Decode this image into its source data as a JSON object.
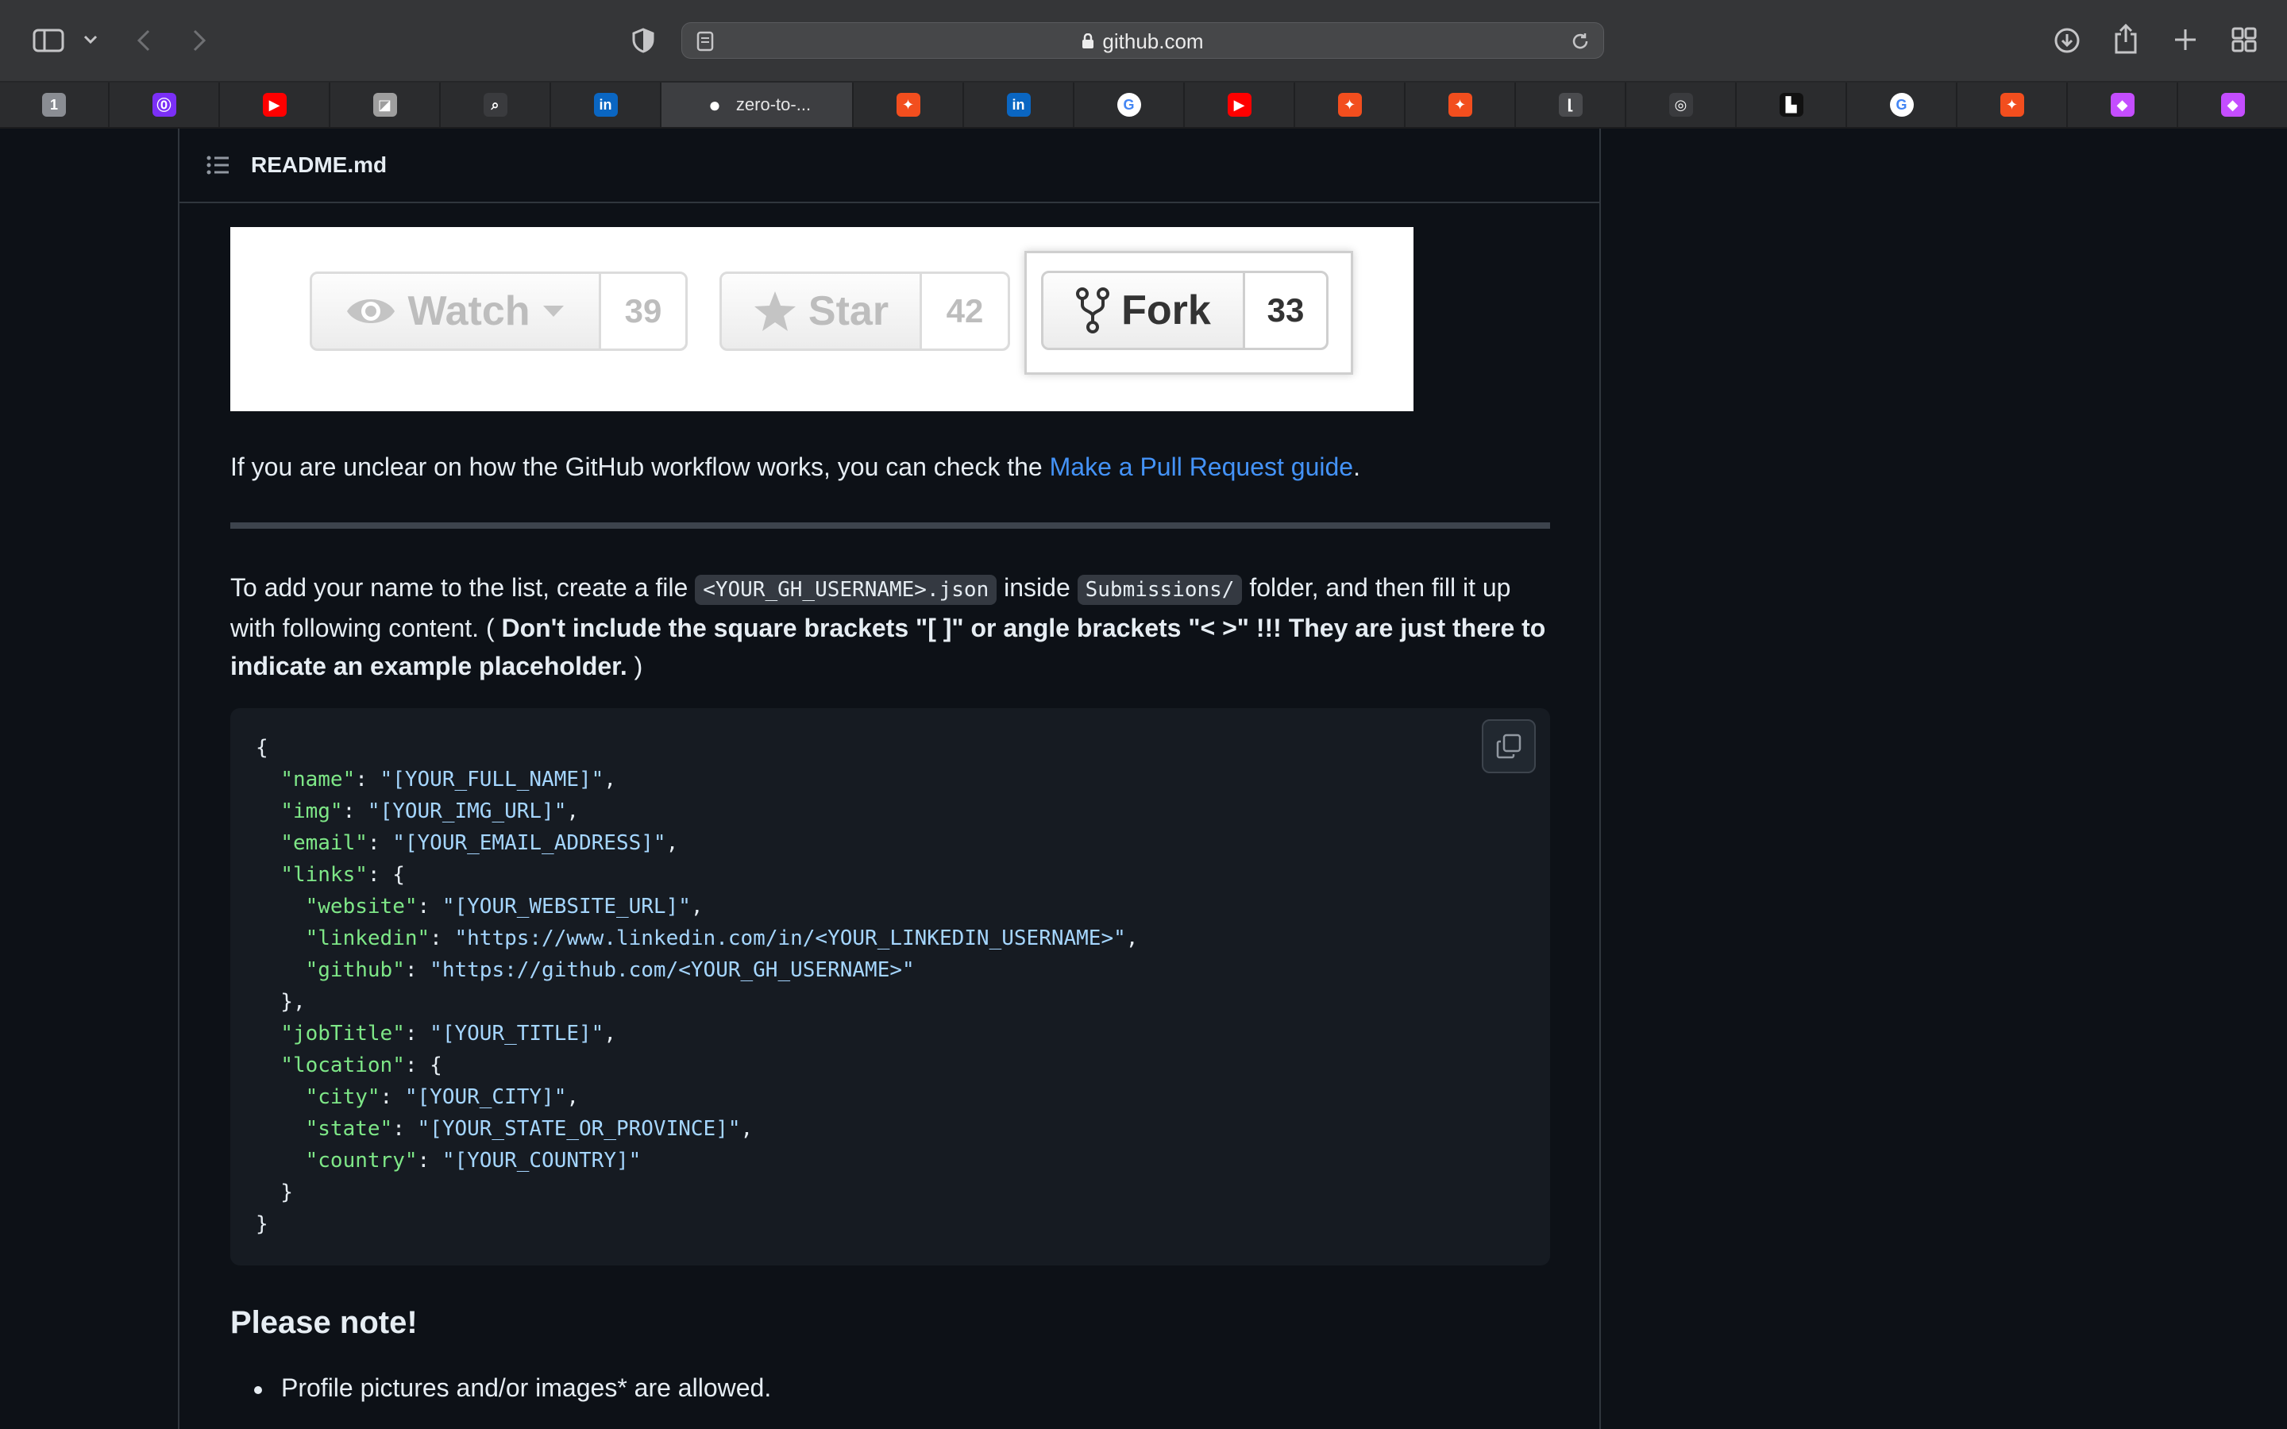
{
  "browser": {
    "url": "github.com",
    "active_tab_label": "zero-to-...",
    "tabs": [
      {
        "icon": "1password-icon",
        "color": "#8a8d93",
        "glyph": "1"
      },
      {
        "icon": "app-icon",
        "color": "#7b2ff7",
        "glyph": "⓪"
      },
      {
        "icon": "youtube-icon",
        "color": "#ff0000",
        "glyph": "▶"
      },
      {
        "icon": "app-icon",
        "color": "#9e9e9e",
        "glyph": "◪"
      },
      {
        "icon": "search-app-icon",
        "color": "#3a3b3e",
        "glyph": "⌕"
      },
      {
        "icon": "linkedin-icon",
        "color": "#0a66c2",
        "glyph": "in"
      },
      {
        "icon": "github-icon",
        "color": "#3d3e41",
        "glyph": "●"
      },
      {
        "icon": "figma-icon",
        "color": "#f24e1e",
        "glyph": "✦"
      },
      {
        "icon": "linkedin-icon",
        "color": "#0a66c2",
        "glyph": "in"
      },
      {
        "icon": "google-icon",
        "color": "#ffffff",
        "glyph": "G"
      },
      {
        "icon": "youtube-icon",
        "color": "#ff0000",
        "glyph": "▶"
      },
      {
        "icon": "figma-icon",
        "color": "#f24e1e",
        "glyph": "✦"
      },
      {
        "icon": "figma-icon",
        "color": "#f24e1e",
        "glyph": "✦"
      },
      {
        "icon": "app-icon",
        "color": "#4a4b4e",
        "glyph": "⌊"
      },
      {
        "icon": "compass-icon",
        "color": "#3a3b3e",
        "glyph": "◎"
      },
      {
        "icon": "unsplash-icon",
        "color": "#111111",
        "glyph": "▙"
      },
      {
        "icon": "google-icon",
        "color": "#ffffff",
        "glyph": "G"
      },
      {
        "icon": "figma-icon",
        "color": "#f24e1e",
        "glyph": "✦"
      },
      {
        "icon": "app-icon",
        "color": "#c44dff",
        "glyph": "◆"
      },
      {
        "icon": "app-icon",
        "color": "#c44dff",
        "glyph": "◆"
      }
    ]
  },
  "readme": {
    "title": "README.md",
    "buttons": {
      "watch_label": "Watch",
      "watch_count": "39",
      "star_label": "Star",
      "star_count": "42",
      "fork_label": "Fork",
      "fork_count": "33"
    },
    "para1_text": "If you are unclear on how the GitHub workflow works, you can check the ",
    "para1_link": "Make a Pull Request guide",
    "para1_end": ".",
    "para2": {
      "t1": "To add your name to the list, create a file ",
      "code1": "<YOUR_GH_USERNAME>.json",
      "t2": " inside ",
      "code2": "Submissions/",
      "t3": " folder, and then fill it up with following content. ( ",
      "bold": "Don't include the square brackets \"[ ]\" or angle brackets \"< >\" !!! They are just there to indicate an example placeholder.",
      "t4": " )"
    },
    "code": {
      "name_val": "\"[YOUR_FULL_NAME]\"",
      "img_val": "\"[YOUR_IMG_URL]\"",
      "email_val": "\"[YOUR_EMAIL_ADDRESS]\"",
      "website_val": "\"[YOUR_WEBSITE_URL]\"",
      "linkedin_val": "\"https://www.linkedin.com/in/<YOUR_LINKEDIN_USERNAME>\"",
      "github_val": "\"https://github.com/<YOUR_GH_USERNAME>\"",
      "jobtitle_val": "\"[YOUR_TITLE]\"",
      "city_val": "\"[YOUR_CITY]\"",
      "state_val": "\"[YOUR_STATE_OR_PROVINCE]\"",
      "country_val": "\"[YOUR_COUNTRY]\""
    },
    "note_heading": "Please note!",
    "bullets": [
      "Profile pictures and/or images* are allowed."
    ]
  }
}
